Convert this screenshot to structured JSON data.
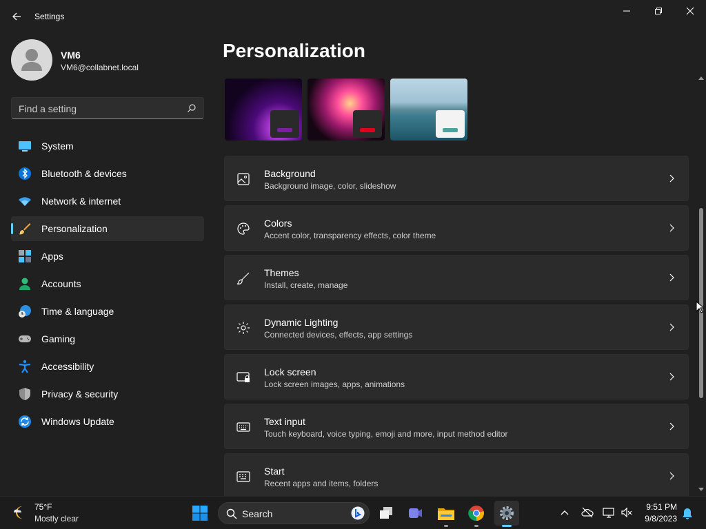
{
  "app": {
    "title": "Settings"
  },
  "user": {
    "name": "VM6",
    "email": "VM6@collabnet.local"
  },
  "search": {
    "placeholder": "Find a setting"
  },
  "nav": [
    {
      "label": "System",
      "icon": "monitor-icon",
      "selected": false
    },
    {
      "label": "Bluetooth & devices",
      "icon": "bluetooth-icon",
      "selected": false
    },
    {
      "label": "Network & internet",
      "icon": "wifi-icon",
      "selected": false
    },
    {
      "label": "Personalization",
      "icon": "brush-icon",
      "selected": true
    },
    {
      "label": "Apps",
      "icon": "apps-icon",
      "selected": false
    },
    {
      "label": "Accounts",
      "icon": "person-icon",
      "selected": false
    },
    {
      "label": "Time & language",
      "icon": "globe-clock-icon",
      "selected": false
    },
    {
      "label": "Gaming",
      "icon": "gamepad-icon",
      "selected": false
    },
    {
      "label": "Accessibility",
      "icon": "accessibility-icon",
      "selected": false
    },
    {
      "label": "Privacy & security",
      "icon": "shield-icon",
      "selected": false
    },
    {
      "label": "Windows Update",
      "icon": "sync-icon",
      "selected": false
    }
  ],
  "page": {
    "title": "Personalization"
  },
  "themes": [
    {
      "name": "purple-glow-theme",
      "accent": "#7a1fa2"
    },
    {
      "name": "flower-theme",
      "accent": "#e3001b"
    },
    {
      "name": "lake-theme",
      "accent": "#4aa3a0"
    }
  ],
  "cards": [
    {
      "title": "Background",
      "subtitle": "Background image, color, slideshow",
      "icon": "image-icon"
    },
    {
      "title": "Colors",
      "subtitle": "Accent color, transparency effects, color theme",
      "icon": "palette-icon"
    },
    {
      "title": "Themes",
      "subtitle": "Install, create, manage",
      "icon": "paintbrush-icon"
    },
    {
      "title": "Dynamic Lighting",
      "subtitle": "Connected devices, effects, app settings",
      "icon": "lighting-icon"
    },
    {
      "title": "Lock screen",
      "subtitle": "Lock screen images, apps, animations",
      "icon": "lock-screen-icon"
    },
    {
      "title": "Text input",
      "subtitle": "Touch keyboard, voice typing, emoji and more, input method editor",
      "icon": "keyboard-icon"
    },
    {
      "title": "Start",
      "subtitle": "Recent apps and items, folders",
      "icon": "start-icon"
    }
  ],
  "taskbar": {
    "weather": {
      "temp": "75°F",
      "condition": "Mostly clear"
    },
    "search_label": "Search",
    "time": "9:51 PM",
    "date": "9/8/2023"
  },
  "colors": {
    "accent": "#60cdff",
    "background": "#202020",
    "card": "#2b2b2b"
  }
}
